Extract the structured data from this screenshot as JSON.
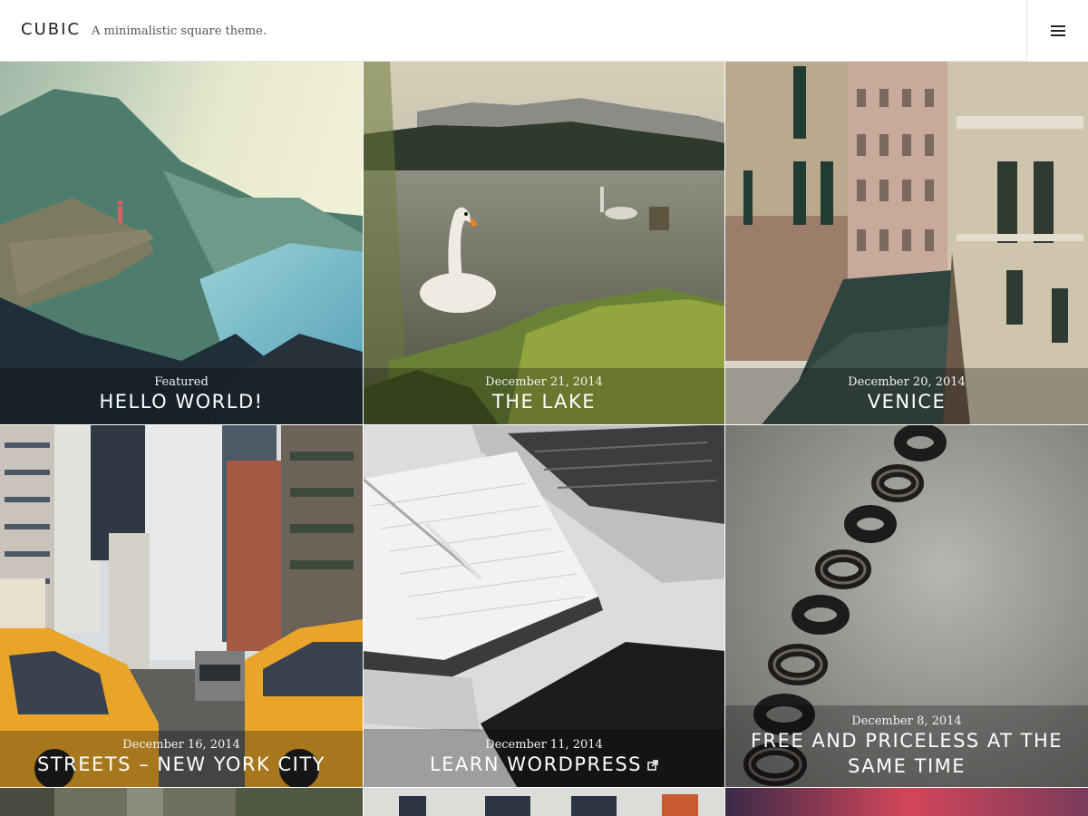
{
  "header": {
    "site_title": "CUBIC",
    "tagline": "A minimalistic square theme.",
    "menu_icon": "hamburger-menu-icon"
  },
  "posts": [
    {
      "meta": "Featured",
      "title": "HELLO WORLD!",
      "image": "mountain-fjord-photo"
    },
    {
      "meta": "December 21, 2014",
      "title": "THE LAKE",
      "image": "swan-lake-photo"
    },
    {
      "meta": "December 20, 2014",
      "title": "VENICE",
      "image": "venice-canal-photo"
    },
    {
      "meta": "December 16, 2014",
      "title": "STREETS – NEW YORK CITY",
      "image": "nyc-taxi-street-photo"
    },
    {
      "meta": "December 11, 2014",
      "title": "LEARN WORDPRESS",
      "image": "notebook-laptop-photo",
      "link_icon": "external-link-icon"
    },
    {
      "meta": "December 8, 2014",
      "title_line1": "FREE AND PRICELESS AT THE",
      "title_line2": "SAME TIME",
      "image": "chain-photo"
    }
  ],
  "colors": {
    "caption_overlay": "rgba(0,0,0,0.28)",
    "header_border": "#e6e6e6",
    "taxi_yellow": "#e8a52a"
  }
}
